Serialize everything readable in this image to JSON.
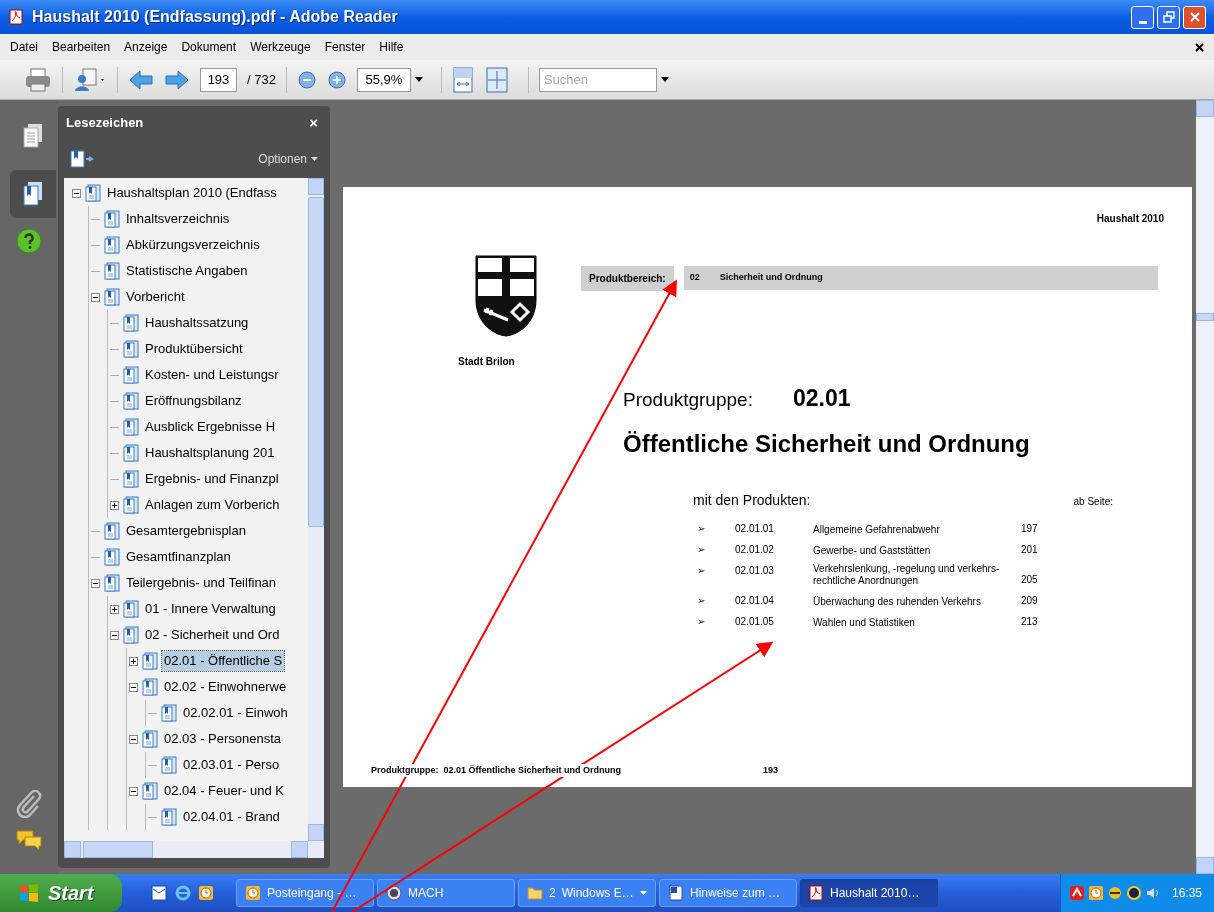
{
  "window": {
    "title": "Haushalt 2010 (Endfassung).pdf - Adobe Reader"
  },
  "menu": [
    "Datei",
    "Bearbeiten",
    "Anzeige",
    "Dokument",
    "Werkzeuge",
    "Fenster",
    "Hilfe"
  ],
  "toolbar": {
    "page": "193",
    "page_count": "/ 732",
    "zoom": "55,9%",
    "search_placeholder": "Suchen"
  },
  "side_tabs": [
    {
      "kind": "pages",
      "selected": false
    },
    {
      "kind": "bookmarks",
      "selected": true
    }
  ],
  "bookmarks": {
    "title": "Lesezeichen",
    "close": "×",
    "options": "Optionen",
    "tree": [
      {
        "label": "Haushaltsplan 2010 (Endfass",
        "selected": false,
        "expanded": true,
        "children": [
          {
            "label": "Inhaltsverzeichnis",
            "selected": false
          },
          {
            "label": "Abkürzungsverzeichnis",
            "selected": false
          },
          {
            "label": "Statistische Angaben",
            "selected": false
          },
          {
            "label": "Vorbericht",
            "selected": false,
            "expanded": true,
            "children": [
              {
                "label": "Haushaltssatzung",
                "selected": false
              },
              {
                "label": "Produktübersicht",
                "selected": false
              },
              {
                "label": "Kosten- und Leistungsr",
                "selected": false
              },
              {
                "label": "Eröffnungsbilanz",
                "selected": false
              },
              {
                "label": "Ausblick Ergebnisse H",
                "selected": false
              },
              {
                "label": "Haushaltsplanung 201",
                "selected": false
              },
              {
                "label": "Ergebnis- und Finanzpl",
                "selected": false
              },
              {
                "label": "Anlagen zum Vorberich",
                "selected": false,
                "expanded": false
              }
            ]
          },
          {
            "label": "Gesamtergebnisplan",
            "selected": false
          },
          {
            "label": "Gesamtfinanzplan",
            "selected": false
          },
          {
            "label": "Teilergebnis- und Teilfinan",
            "selected": false,
            "expanded": true,
            "children": [
              {
                "label": "01 - Innere Verwaltung",
                "selected": false,
                "expanded": false
              },
              {
                "label": "02 - Sicherheit und Ord",
                "selected": false,
                "expanded": true,
                "children": [
                  {
                    "label": "02.01 - Öffentliche S",
                    "selected": true,
                    "expanded": false
                  },
                  {
                    "label": "02.02 - Einwohnerwe",
                    "selected": false,
                    "expanded": true,
                    "children": [
                      {
                        "label": "02.02.01 - Einwoh",
                        "selected": false
                      }
                    ]
                  },
                  {
                    "label": "02.03 - Personensta",
                    "selected": false,
                    "expanded": true,
                    "children": [
                      {
                        "label": "02.03.01 - Perso",
                        "selected": false
                      }
                    ]
                  },
                  {
                    "label": "02.04 - Feuer- und K",
                    "selected": false,
                    "expanded": true,
                    "children": [
                      {
                        "label": "02.04.01 - Brand",
                        "selected": false
                      }
                    ]
                  }
                ]
              }
            ]
          }
        ]
      }
    ]
  },
  "page": {
    "header": "Haushalt 2010",
    "area_label": "Produktbereich:",
    "area_code": "02",
    "area_name": "Sicherheit und Ordnung",
    "city": "Stadt Brilon",
    "group_label": "Produktgruppe:",
    "group_code": "02.01",
    "group_title": "Öffentliche Sicherheit und Ordnung",
    "products_heading": "mit den Produkten:",
    "page_heading": "ab Seite:",
    "products": [
      {
        "bullet": "➢",
        "code": "02.01.01",
        "name": "Allgemeine Gefahrenabwehr",
        "page": "197"
      },
      {
        "bullet": "➢",
        "code": "02.01.02",
        "name": "Gewerbe- und Gaststätten",
        "page": "201"
      },
      {
        "bullet": "➢",
        "code": "02.01.03",
        "name": "Verkehrslenkung, -regelung und verkehrs-rechtliche Anordnungen",
        "page": "205"
      },
      {
        "bullet": "➢",
        "code": "02.01.04",
        "name": "Überwachung des ruhenden Verkehrs",
        "page": "209"
      },
      {
        "bullet": "➢",
        "code": "02.01.05",
        "name": "Wahlen und Statistiken",
        "page": "213"
      }
    ],
    "footer": "Produktgruppe:  02.01 Öffentliche Sicherheit und Ordnung",
    "footer_page": "193"
  },
  "taskbar": {
    "start": "Start",
    "tasks": [
      {
        "kind": "clock",
        "label": "Posteingang - …",
        "selected": false
      },
      {
        "kind": "app",
        "label": "MACH",
        "selected": false
      },
      {
        "kind": "group",
        "count": "2",
        "label": "Windows E…",
        "selected": false
      },
      {
        "kind": "doc",
        "label": "Hinweise zum …",
        "selected": false
      },
      {
        "kind": "pdf",
        "label": "Haushalt 2010…",
        "selected": true
      }
    ],
    "time": "16:35"
  }
}
